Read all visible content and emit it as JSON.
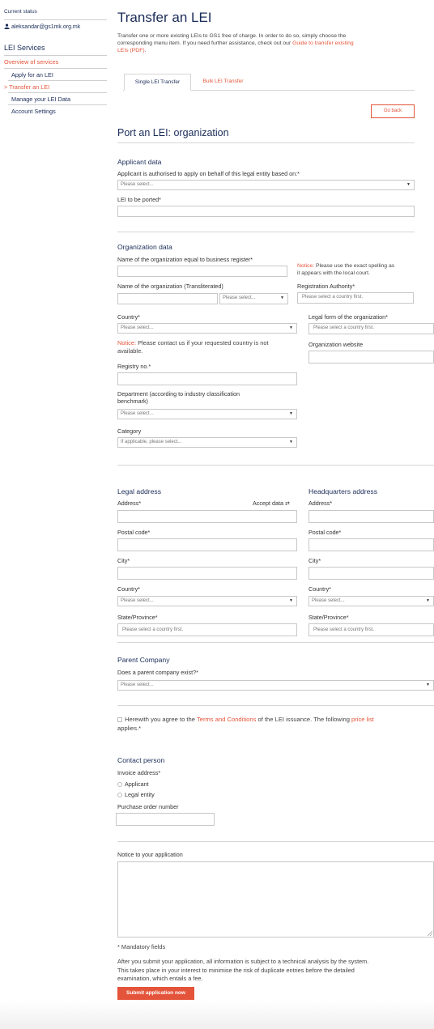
{
  "sidebar": {
    "current_status": "Current status",
    "user_email": "aleksandar@gs1mk.org.mk",
    "section_title": "LEI Services",
    "items": [
      {
        "label": "Overview of services"
      },
      {
        "label": "Apply for an LEI"
      },
      {
        "label": "Transfer an LEI"
      },
      {
        "label": "Manage your LEI Data"
      },
      {
        "label": "Account Settings"
      }
    ],
    "active_marker": ">"
  },
  "page": {
    "title": "Transfer an LEI",
    "intro_1": "Transfer one or more existing LEIs to GS1 free of charge. In order to do so, simply choose the",
    "intro_2": "corresponding menu item. If you need further assistance, check out our ",
    "intro_link": "Guide to transfer existing",
    "intro_link_2": "LEIs (PDF)",
    "intro_end": ".",
    "tabs": [
      {
        "label": "Single LEI Transfer"
      },
      {
        "label": "Bulk LEI Transfer"
      }
    ],
    "go_back": "Go back",
    "form_title": "Port an LEI: organization"
  },
  "applicant": {
    "title": "Applicant data",
    "basis_label": "Applicant is authorised to apply on behalf of this legal entity based on:*",
    "basis_placeholder": "Please select...",
    "lei_label": "LEI to be ported*"
  },
  "organization": {
    "title": "Organization data",
    "name_label": "Name of the organization equal to business register*",
    "notice_word": "Notice:",
    "notice_text_1": " Please use the exact spelling as",
    "notice_text_2": "it appears with the local court.",
    "translit_label": "Name of the organization (Transliterated)",
    "translit_select": "Please select...",
    "reg_authority_label": "Registration Authority*",
    "reg_authority_placeholder": "Please select a country first.",
    "country_label": "Country*",
    "country_placeholder": "Please select...",
    "legal_form_label": "Legal form of the organization*",
    "legal_form_placeholder": "Please select a country first.",
    "country_notice_word": "Notice:",
    "country_notice_1": " Please contact us if your requested country is not",
    "country_notice_2": "available.",
    "website_label": "Organization website",
    "registry_label": "Registry no.*",
    "dept_label_1": "Department (according to industry classification",
    "dept_label_2": "benchmark)",
    "dept_placeholder": "Please select...",
    "category_label": "Category",
    "category_placeholder": "If applicable, please select..."
  },
  "legal_address": {
    "title": "Legal address",
    "address_label": "Address*",
    "accept_data": "Accept data ⇄",
    "postal_label": "Postal code*",
    "city_label": "City*",
    "country_label": "Country*",
    "country_placeholder": "Please select...",
    "state_label": "State/Province*",
    "state_placeholder": "Please select a country first."
  },
  "hq_address": {
    "title": "Headquarters address",
    "address_label": "Address*",
    "postal_label": "Postal code*",
    "city_label": "City*",
    "country_label": "Country*",
    "country_placeholder": "Please select...",
    "state_label": "State/Province*",
    "state_placeholder": "Please select a country first."
  },
  "parent": {
    "title": "Parent Company",
    "question": "Does a parent company exist?*",
    "placeholder": "Please select..."
  },
  "terms": {
    "text_1": "Herewith you agree to the ",
    "terms_link": "Terms and Conditions",
    "text_2": " of the LEI issuance. The following ",
    "price_link": "price list",
    "text_3": "applies.*"
  },
  "contact": {
    "title": "Contact person",
    "invoice_label": "Invoice address*",
    "options": [
      {
        "label": "Applicant"
      },
      {
        "label": "Legal entity"
      }
    ],
    "po_label": "Purchase order number"
  },
  "notice_app": {
    "label": "Notice to your application"
  },
  "footer": {
    "mandatory": "* Mandatory fields",
    "info_1": "After you submit your application, all information is subject to a technical analysis by the system.",
    "info_2": "This takes place in your interest to minimise the risk of duplicate entries before the detailed",
    "info_3": "examination, which entails a fee.",
    "submit": "Submit application now"
  },
  "colors": {
    "accent": "#e4543a",
    "navy": "#1a2c58"
  },
  "icons": {
    "user": "user-icon",
    "chevron": "chevron-down-icon"
  }
}
